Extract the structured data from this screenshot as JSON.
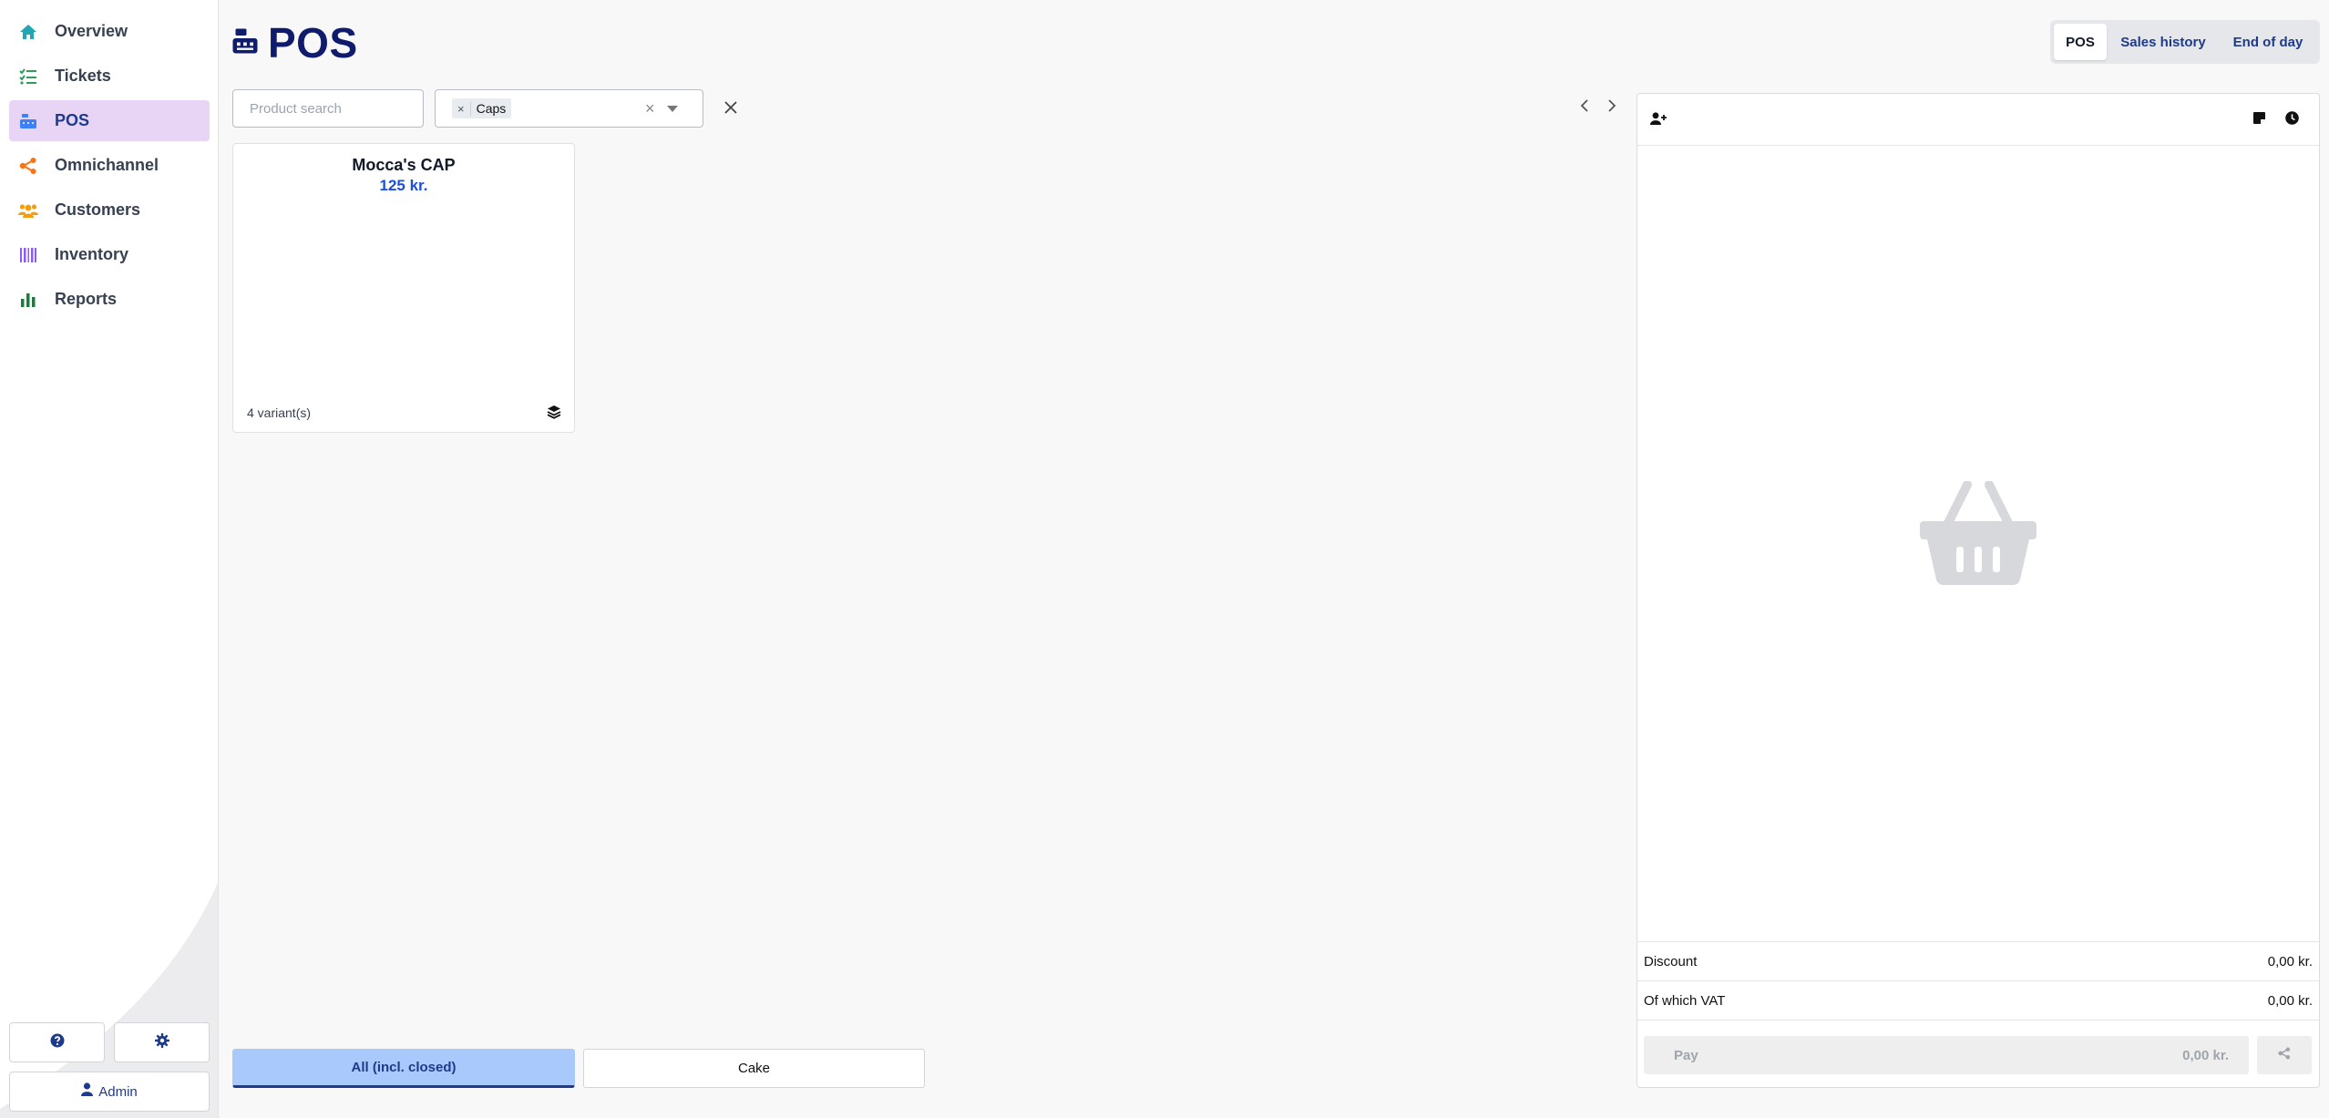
{
  "sidebar": {
    "items": [
      {
        "label": "Overview",
        "icon": "home-icon",
        "color": "#22a6b3"
      },
      {
        "label": "Tickets",
        "icon": "tasks-icon",
        "color": "#2e9e5b"
      },
      {
        "label": "POS",
        "icon": "cash-register-icon",
        "color": "#3b82f6",
        "active": true
      },
      {
        "label": "Omnichannel",
        "icon": "share-nodes-icon",
        "color": "#f97316"
      },
      {
        "label": "Customers",
        "icon": "users-icon",
        "color": "#f59e0b"
      },
      {
        "label": "Inventory",
        "icon": "barcode-icon",
        "color": "#8b5cf6"
      },
      {
        "label": "Reports",
        "icon": "bar-chart-icon",
        "color": "#15803d"
      }
    ],
    "help_icon": "question-circle-icon",
    "settings_icon": "gear-icon",
    "user_label": "Admin"
  },
  "header": {
    "title": "POS",
    "tabs": [
      {
        "label": "POS",
        "active": true
      },
      {
        "label": "Sales history",
        "active": false
      },
      {
        "label": "End of day",
        "active": false
      }
    ]
  },
  "filters": {
    "search_placeholder": "Product search",
    "selected_category": "Caps",
    "chip_remove": "×",
    "clear_value": "×"
  },
  "products": [
    {
      "name": "Mocca's CAP",
      "price": "125 kr.",
      "variants": "4 variant(s)"
    }
  ],
  "categories": [
    {
      "label": "All (incl. closed)",
      "active": true
    },
    {
      "label": "Cake",
      "active": false
    }
  ],
  "cart": {
    "discount_label": "Discount",
    "discount_value": "0,00 kr.",
    "vat_label": "Of which VAT",
    "vat_value": "0,00 kr.",
    "pay_label": "Pay",
    "pay_value": "0,00 kr."
  },
  "colors": {
    "accent": "#1e3a8a",
    "active_nav": "#e8d5f5",
    "active_category": "#a9c9fc",
    "price": "#1d4ed8"
  }
}
